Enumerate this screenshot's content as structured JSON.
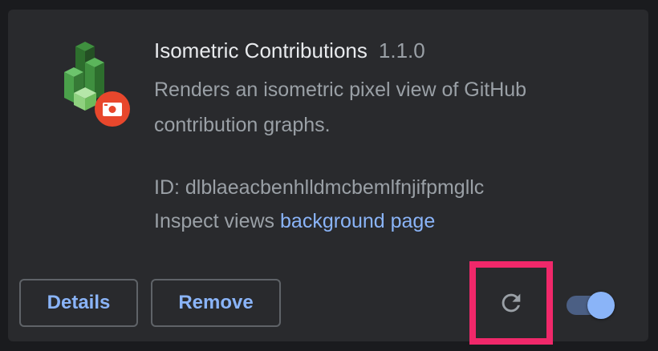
{
  "extension": {
    "name": "Isometric Contributions",
    "version": "1.1.0",
    "description": "Renders an isometric pixel view of GitHub contribution graphs.",
    "id_line": "ID: dlblaeacbenhlldmcbemlfnjifpmgllc",
    "inspect_label": "Inspect views",
    "inspect_link": "background page",
    "icon": "green-isometric-cubes-icon",
    "badge_icon": "red-camera-badge-icon"
  },
  "actions": {
    "details_label": "Details",
    "remove_label": "Remove",
    "reload_icon": "reload-icon",
    "enabled": true
  },
  "colors": {
    "card_background": "#292a2d",
    "page_background": "#1a1b1e",
    "accent_blue": "#8ab4f8",
    "highlight_pink": "#f0286a",
    "badge_red": "#e8472c"
  }
}
